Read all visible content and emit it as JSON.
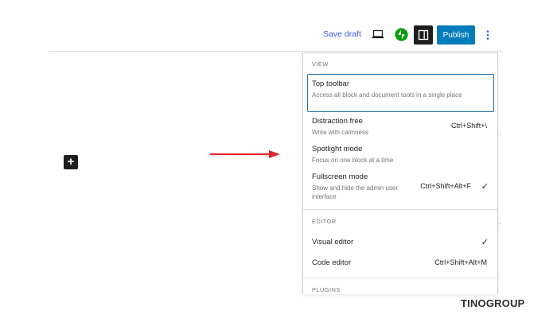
{
  "header": {
    "save_draft": "Save draft",
    "publish": "Publish"
  },
  "menu": {
    "view": {
      "heading": "VIEW",
      "items": [
        {
          "title": "Top toolbar",
          "desc": "Access all block and document tools in a single place",
          "shortcut": ""
        },
        {
          "title": "Distraction free",
          "desc": "Write with calmness",
          "shortcut": "Ctrl+Shift+\\"
        },
        {
          "title": "Spotlight mode",
          "desc": "Focus on one block at a time",
          "shortcut": ""
        },
        {
          "title": "Fullscreen mode",
          "desc": "Show and hide the admin user interface",
          "shortcut": "Ctrl+Shift+Alt+F",
          "checked": "✓"
        }
      ]
    },
    "editor": {
      "heading": "EDITOR",
      "items": [
        {
          "title": "Visual editor",
          "shortcut": "",
          "checked": "✓"
        },
        {
          "title": "Code editor",
          "shortcut": "Ctrl+Shift+Alt+M"
        }
      ]
    },
    "plugins": {
      "heading": "PLUGINS"
    }
  },
  "canvas": {
    "add_block_symbol": "+"
  },
  "brand": {
    "part1": "TINO",
    "part2": "GROUP"
  },
  "colors": {
    "accent": "#007cba",
    "arrow": "#e3262b",
    "jetpack": "#069e08"
  },
  "icons": [
    "desktop-preview-icon",
    "jetpack-icon",
    "settings-sidebar-icon",
    "more-options-icon",
    "plus-icon",
    "check-icon"
  ]
}
